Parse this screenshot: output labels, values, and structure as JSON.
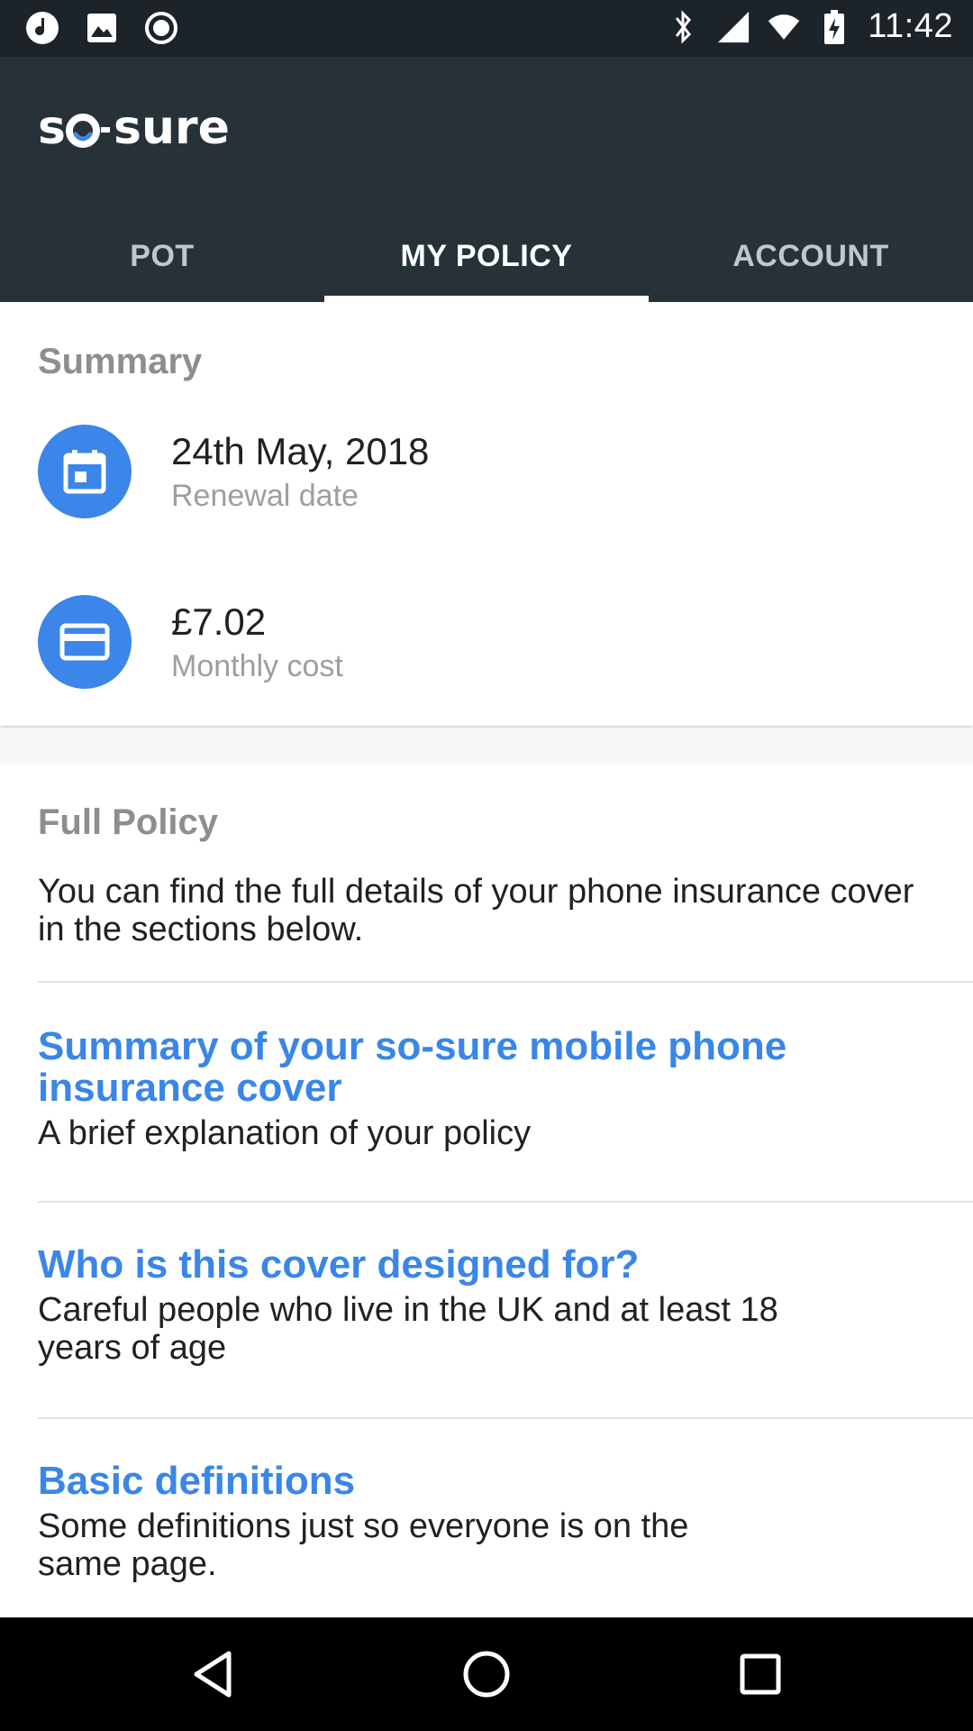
{
  "status_bar": {
    "time": "11:42",
    "left_icons": [
      "music-note-icon",
      "image-icon",
      "record-icon"
    ],
    "right_icons": [
      "bluetooth-icon",
      "signal-icon",
      "wifi-icon",
      "battery-charging-icon"
    ]
  },
  "app": {
    "logo": "so-sure",
    "accent_color": "#3b86e8",
    "appbar_color": "#263238"
  },
  "tabs": [
    {
      "label": "POT",
      "active": false
    },
    {
      "label": "MY POLICY",
      "active": true
    },
    {
      "label": "ACCOUNT",
      "active": false
    }
  ],
  "summary": {
    "title": "Summary",
    "items": [
      {
        "icon": "calendar-icon",
        "value": "24th May, 2018",
        "label": "Renewal date"
      },
      {
        "icon": "credit-card-icon",
        "value": "£7.02",
        "label": "Monthly cost"
      }
    ]
  },
  "full_policy": {
    "title": "Full Policy",
    "intro": "You can find the full details of your phone insurance cover in the sections below.",
    "sections": [
      {
        "title": "Summary of your so-sure mobile phone insurance cover",
        "description": "A brief explanation of your policy"
      },
      {
        "title": "Who is this cover designed for?",
        "description": "Careful people who live in the UK and at least 18 years of age"
      },
      {
        "title": "Basic definitions",
        "description": "Some definitions just so everyone is on the same page."
      }
    ]
  },
  "nav_bar": {
    "buttons": [
      "back-icon",
      "home-icon",
      "recents-icon"
    ]
  }
}
